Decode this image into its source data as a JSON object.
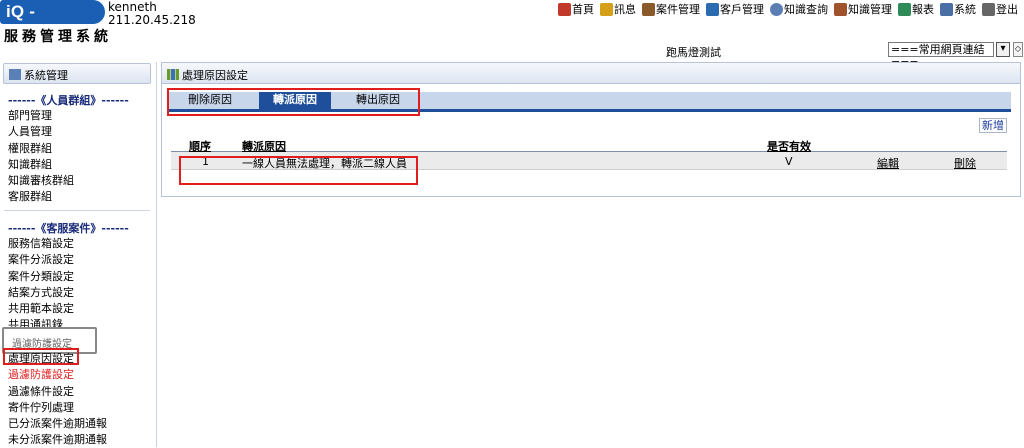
{
  "header": {
    "logo": "iQ - Support",
    "username": "kenneth",
    "ip": "211.20.45.218",
    "system_title": "服務管理系統",
    "nav": [
      {
        "label": "首頁",
        "icon": "home-icon",
        "color": "#c0392b"
      },
      {
        "label": "訊息",
        "icon": "mail-icon",
        "color": "#d4a017"
      },
      {
        "label": "案件管理",
        "icon": "case-icon",
        "color": "#8b5a2b"
      },
      {
        "label": "客戶管理",
        "icon": "customer-icon",
        "color": "#2b6cb0"
      },
      {
        "label": "知識查詢",
        "icon": "search-icon",
        "color": "#5b7fb5"
      },
      {
        "label": "知識管理",
        "icon": "knowledge-icon",
        "color": "#a0522d"
      },
      {
        "label": "報表",
        "icon": "report-icon",
        "color": "#2e8b57"
      },
      {
        "label": "系統",
        "icon": "system-icon",
        "color": "#4a6fa5"
      },
      {
        "label": "登出",
        "icon": "logout-icon",
        "color": "#666666"
      }
    ],
    "marquee": "跑馬燈測試",
    "quicklinks_selected": "===常用網頁連結==="
  },
  "sidebar": {
    "title": "系統管理",
    "group1_title": "------《人員群組》------",
    "group1_items": [
      "部門管理",
      "人員管理",
      "權限群組",
      "知識群組",
      "知識審核群組",
      "客服群組"
    ],
    "group2_title": "------《客服案件》------",
    "group2_items": [
      "服務信箱設定",
      "案件分派設定",
      "案件分類設定",
      "結案方式設定",
      "共用範本設定",
      "共用通訊錄"
    ],
    "tooltip": "過濾防護設定",
    "group2_items_b": [
      "處理原因設定",
      "過濾防護設定",
      "過濾條件設定",
      "寄件佇列處理",
      "已分派案件逾期通報",
      "未分派案件逾期通報"
    ]
  },
  "main": {
    "title": "處理原因設定",
    "tabs": [
      "刪除原因",
      "轉派原因",
      "轉出原因"
    ],
    "active_tab": 1,
    "add_label": "新增",
    "columns": [
      "順序",
      "轉派原因",
      "是否有效"
    ],
    "rows": [
      {
        "order": "1",
        "reason": "一線人員無法處理，轉派二線人員",
        "valid": "V",
        "edit": "編輯",
        "delete": "刪除"
      }
    ]
  },
  "colors": {
    "accent": "#1f4f9a",
    "highlight_box": "#e01e1e",
    "hover_link": "#e01e1e"
  }
}
